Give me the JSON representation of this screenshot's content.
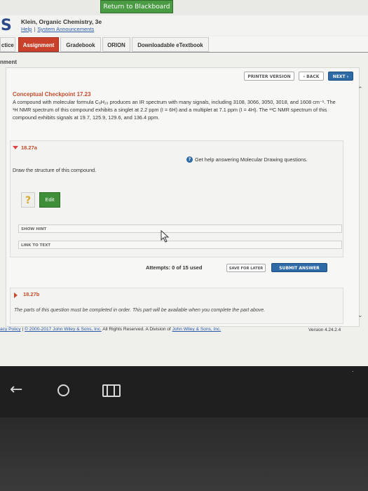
{
  "blackboard": {
    "return_label": "Return to Blackboard"
  },
  "header": {
    "logo": "S",
    "title": "Klein, Organic Chemistry, 3e",
    "help": "Help",
    "system_announcements": "System Announcements"
  },
  "tabs": [
    {
      "label": "ctice"
    },
    {
      "label": "Assignment"
    },
    {
      "label": "Gradebook"
    },
    {
      "label": "ORION"
    },
    {
      "label": "Downloadable eTextbook"
    }
  ],
  "section_label": "nment",
  "nav": {
    "printer": "PRINTER VERSION",
    "back": "‹ BACK",
    "next": "NEXT ›"
  },
  "checkpoint": {
    "title": "Conceptual Checkpoint 17.23",
    "text": "A compound with molecular formula C₉H₁₀ produces an IR spectrum with many signals, including 3108, 3066, 3050, 3018, and 1608 cm⁻¹. The ¹H NMR spectrum of this compound exhibits a singlet at 2.2 ppm (I = 6H) and a multiplet at 7.1 ppm (I = 4H). The ¹³C NMR spectrum of this compound exhibits signals at 19.7, 125.9, 129.6, and 136.4 ppm."
  },
  "question": {
    "number": "18.27a",
    "help_text": "Get help answering Molecular Drawing questions.",
    "prompt": "Draw the structure of this compound.",
    "placeholder_icon": "?",
    "edit_label": "Edit",
    "show_hint": "SHOW HINT",
    "link_to_text": "LINK TO TEXT",
    "attempts": "Attempts: 0 of 15 used",
    "save_later": "SAVE FOR LATER",
    "submit": "SUBMIT ANSWER"
  },
  "question2": {
    "number": "18.27b",
    "text": "The parts of this question must be completed in order. This part will be available when you complete the part above."
  },
  "footer": {
    "privacy": "acy Policy",
    "separator": "|",
    "copyright_link": "© 2000-2017 John Wiley & Sons, Inc.",
    "rights": " All Rights Reserved. A Division of ",
    "company": "John Wiley & Sons, Inc.",
    "version": "Version 4.24.2.4"
  },
  "colors": {
    "accent_tab": "#c9412a",
    "primary_button": "#2e6aa6",
    "edit_button": "#3e8e3a",
    "blackboard": "#4a9b43"
  }
}
